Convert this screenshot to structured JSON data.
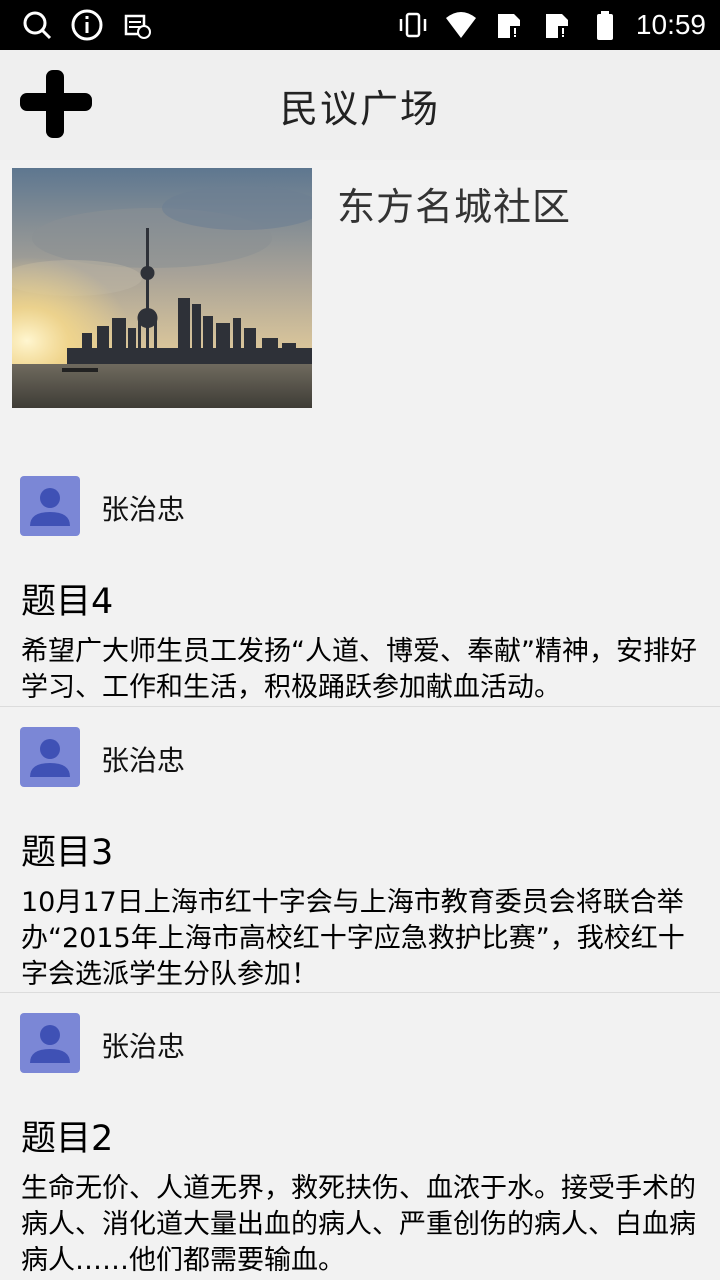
{
  "status_bar": {
    "time": "10:59"
  },
  "header": {
    "title": "民议广场",
    "add_icon": "plus-icon"
  },
  "community": {
    "name": "东方名城社区",
    "photo": "city-skyline-photo"
  },
  "posts": [
    {
      "author": "张治忠",
      "title": "题目4",
      "content": "希望广大师生员工发扬“人道、博爱、奉献”精神，安排好学习、工作和生活，积极踊跃参加献血活动。"
    },
    {
      "author": "张治忠",
      "title": "题目3",
      "content": "10月17日上海市红十字会与上海市教育委员会将联合举办“2015年上海市高校红十字应急救护比赛”，我校红十字会选派学生分队参加！"
    },
    {
      "author": "张治忠",
      "title": "题目2",
      "content": "生命无价、人道无界，救死扶伤、血浓于水。接受手术的病人、消化道大量出血的病人、严重创伤的病人、白血病病人……他们都需要输血。"
    }
  ]
}
